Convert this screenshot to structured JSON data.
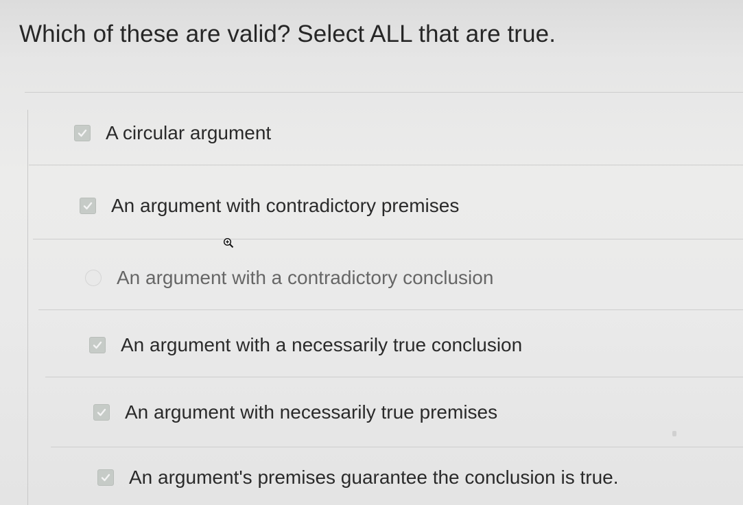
{
  "question": {
    "text": "Which of these are valid? Select ALL that are true."
  },
  "options": [
    {
      "label": "A circular argument",
      "checked": true
    },
    {
      "label": "An argument with contradictory premises",
      "checked": true
    },
    {
      "label": "An argument with a contradictory conclusion",
      "checked": false
    },
    {
      "label": "An argument with a necessarily true conclusion",
      "checked": true
    },
    {
      "label": "An argument with necessarily true premises",
      "checked": true
    },
    {
      "label": "An argument's premises guarantee the conclusion is true.",
      "checked": true
    }
  ],
  "cursor_icon": "zoom-in-icon",
  "colors": {
    "background": "#e8e8e8",
    "text": "#2a2a2a",
    "checkbox_checked": "#c6cbc7"
  }
}
